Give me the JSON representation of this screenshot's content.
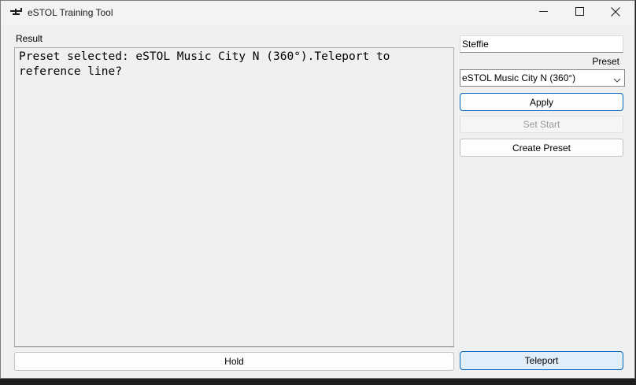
{
  "window": {
    "title": "eSTOL Training Tool",
    "icon": "airplane-icon"
  },
  "titlebar_controls": {
    "minimize_icon": "minimize-icon",
    "maximize_icon": "maximize-icon",
    "close_icon": "close-icon"
  },
  "result": {
    "label": "Result",
    "text": "Preset selected: eSTOL Music City N (360°).Teleport to reference line?"
  },
  "sidebar": {
    "name_value": "Steffie",
    "preset_label": "Preset",
    "preset_selected": "eSTOL Music City N (360°)",
    "apply_label": "Apply",
    "set_start_label": "Set Start",
    "create_preset_label": "Create Preset",
    "teleport_label": "Teleport"
  },
  "bottom": {
    "hold_label": "Hold"
  },
  "colors": {
    "accent": "#0067c0",
    "window_bg": "#f0f0f0",
    "teleport_bg": "#e0eef9",
    "disabled_text": "#9a9a9a"
  }
}
